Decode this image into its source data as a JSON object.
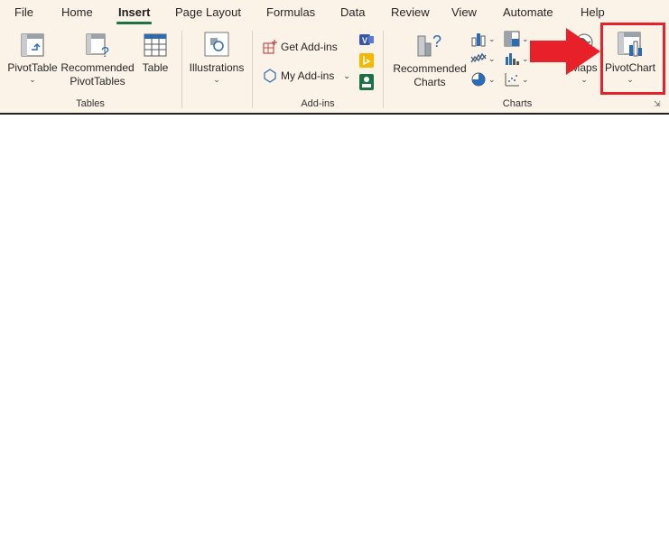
{
  "tabs": [
    {
      "label": "File"
    },
    {
      "label": "Home"
    },
    {
      "label": "Insert"
    },
    {
      "label": "Page Layout"
    },
    {
      "label": "Formulas"
    },
    {
      "label": "Data"
    },
    {
      "label": "Review"
    },
    {
      "label": "View"
    },
    {
      "label": "Automate"
    },
    {
      "label": "Help"
    }
  ],
  "groups": {
    "tables": {
      "label": "Tables",
      "pivottable": "PivotTable",
      "recommended_line1": "Recommended",
      "recommended_line2": "PivotTables",
      "table": "Table"
    },
    "illustrations": {
      "label": "Illustrations"
    },
    "addins": {
      "label": "Add-ins",
      "get": "Get Add-ins",
      "my": "My Add-ins"
    },
    "charts": {
      "label": "Charts",
      "recommended_line1": "Recommended",
      "recommended_line2": "Charts",
      "maps": "Maps",
      "pivotchart": "PivotChart"
    }
  },
  "colors": {
    "ribbon_bg": "#fbf3e8",
    "active_tab_underline": "#1e7145",
    "highlight": "#e8202a"
  }
}
